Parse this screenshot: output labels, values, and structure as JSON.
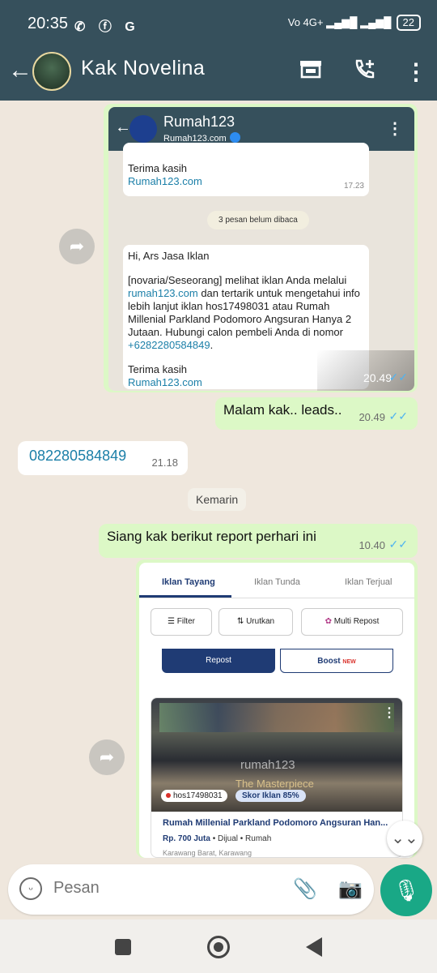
{
  "status": {
    "time": "20:35",
    "icons": "✆ ⓕ G",
    "network": "Vo 4G+ ▂▄▆█ ▂▄▆█",
    "battery": "22"
  },
  "header": {
    "contact_name": "Kak Novelina"
  },
  "forwarded_image_1": {
    "app_title": "Rumah123",
    "app_subtitle": "Rumah123.com",
    "first_card": {
      "thanks": "Terima kasih",
      "link": "Rumah123.com",
      "time": "17.23"
    },
    "unread": "3 pesan belum dibaca",
    "second_card": {
      "greeting": "Hi, Ars Jasa Iklan",
      "body_start": "[novaria/Seseorang] melihat iklan Anda melalui",
      "body_link": "rumah123.com",
      "body_rest": " dan tertarik untuk mengetahui info lebih lanjut iklan hos17498031 atau Rumah Millenial Parkland Podomoro Angsuran Hanya 2 Jutaan. Hubungi calon pembeli Anda di nomor",
      "phone": "+6282280584849",
      "thanks": "Terima kasih",
      "link": "Rumah123.com"
    },
    "time": "20.49"
  },
  "messages": {
    "out1": {
      "text": "Malam kak.. leads..",
      "time": "20.49"
    },
    "in1": {
      "text": "082280584849",
      "time": "21.18"
    },
    "date_chip": "Kemarin",
    "out2": {
      "text": "Siang kak berikut report perhari ini",
      "time": "10.40"
    }
  },
  "forwarded_image_2": {
    "tabs": [
      "Iklan Tayang",
      "Iklan Tunda",
      "Iklan Terjual"
    ],
    "filter": "Filter",
    "sort": "Urutkan",
    "multi_repost": "Multi Repost",
    "repost": "Repost",
    "boost": "Boost",
    "boost_badge": "NEW",
    "photo_watermark": "rumah123",
    "photo_caption": "The Masterpiece",
    "listing_id": "hos17498031",
    "score": "Skor Iklan 85%",
    "listing_title": "Rumah Millenial Parkland Podomoro Angsuran Han...",
    "price": "Rp. 700 Juta",
    "price_meta": " • Dijual • Rumah",
    "location": "Karawang Barat, Karawang"
  },
  "composer": {
    "placeholder": "Pesan"
  },
  "colors": {
    "appbar": "#36505c",
    "outgoing": "#dcf8c6",
    "mic": "#19a886",
    "tick": "#4fb3f0"
  }
}
